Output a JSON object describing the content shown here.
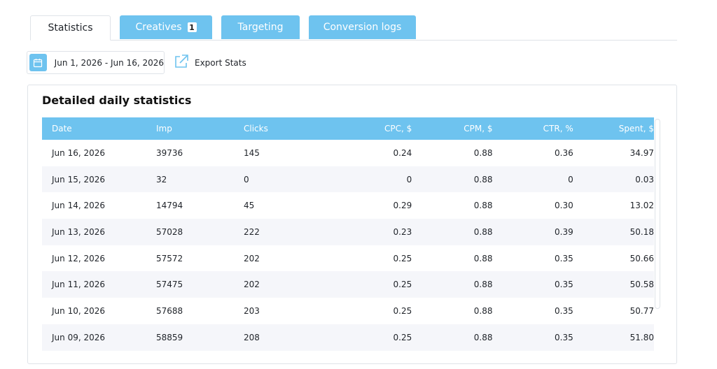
{
  "tabs": [
    {
      "label": "Statistics",
      "active": true
    },
    {
      "label": "Creatives",
      "badge": "1",
      "active": false
    },
    {
      "label": "Targeting",
      "active": false
    },
    {
      "label": "Conversion logs",
      "active": false
    }
  ],
  "toolbar": {
    "date_range": "Jun 1, 2026  - Jun 16, 2026",
    "calendar_icon": "calendar-icon",
    "export_label": "Export Stats",
    "export_icon": "external-link-icon"
  },
  "panel": {
    "title": "Detailed daily statistics"
  },
  "table": {
    "headers": [
      "Date",
      "Imp",
      "Clicks",
      "CPC, $",
      "CPM, $",
      "CTR, %",
      "Spent, $"
    ],
    "rows": [
      [
        "Jun 16, 2026",
        "39736",
        "145",
        "0.24",
        "0.88",
        "0.36",
        "34.97"
      ],
      [
        "Jun 15, 2026",
        "32",
        "0",
        "0",
        "0.88",
        "0",
        "0.03"
      ],
      [
        "Jun 14, 2026",
        "14794",
        "45",
        "0.29",
        "0.88",
        "0.30",
        "13.02"
      ],
      [
        "Jun 13, 2026",
        "57028",
        "222",
        "0.23",
        "0.88",
        "0.39",
        "50.18"
      ],
      [
        "Jun 12, 2026",
        "57572",
        "202",
        "0.25",
        "0.88",
        "0.35",
        "50.66"
      ],
      [
        "Jun 11, 2026",
        "57475",
        "202",
        "0.25",
        "0.88",
        "0.35",
        "50.58"
      ],
      [
        "Jun 10, 2026",
        "57688",
        "203",
        "0.25",
        "0.88",
        "0.35",
        "50.77"
      ],
      [
        "Jun 09, 2026",
        "58859",
        "208",
        "0.25",
        "0.88",
        "0.35",
        "51.80"
      ]
    ]
  },
  "colors": {
    "accent": "#6ec3ef",
    "stripe": "#f5f6fa",
    "border": "#dfe3e8"
  }
}
